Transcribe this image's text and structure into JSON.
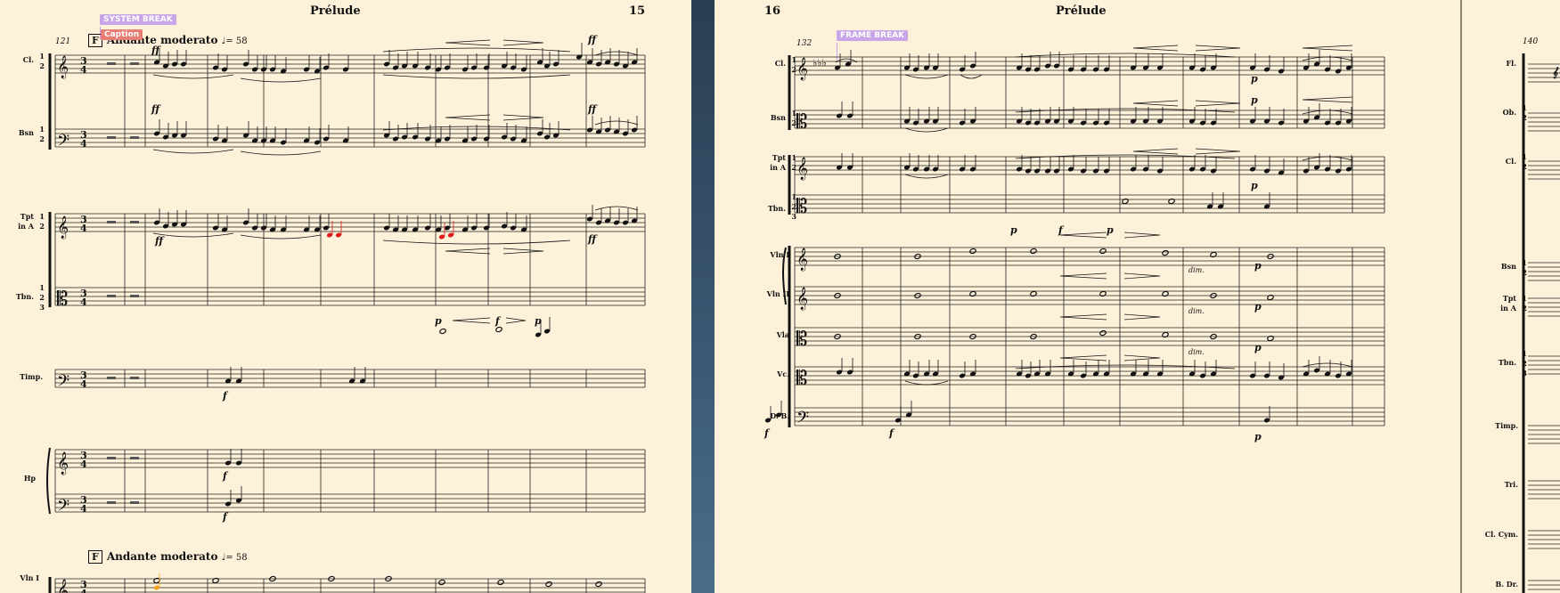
{
  "left_page": {
    "title": "Prélude",
    "page_number": "15",
    "measure_start": "121",
    "rehearsal_mark": "F",
    "tempo": "Andante moderato",
    "metronome": "♩= 58",
    "system_break_label": "SYSTEM BREAK",
    "caption_label": "Caption",
    "instruments": [
      {
        "id": "cl",
        "label": "Cl.",
        "parts": "1\n2"
      },
      {
        "id": "bsn",
        "label": "Bsn",
        "parts": "1\n2"
      },
      {
        "id": "tpt",
        "label": "Tpt\nin A",
        "parts": "1\n2"
      },
      {
        "id": "tbn",
        "label": "Tbn.",
        "parts": "1\n2\n3"
      },
      {
        "id": "timp",
        "label": "Timp.",
        "parts": ""
      },
      {
        "id": "hp",
        "label": "Hp",
        "parts": ""
      },
      {
        "id": "vln1",
        "label": "Vln I",
        "parts": ""
      }
    ],
    "dynamics": [
      "ff",
      "ff",
      "ff",
      "ff",
      "ff",
      "p",
      "f",
      "p",
      "f",
      "f",
      "f"
    ]
  },
  "right_page": {
    "title": "Prélude",
    "page_number": "16",
    "measure_start": "132",
    "frame_break_label": "FRAME BREAK",
    "instruments": [
      {
        "id": "cl",
        "label": "Cl.",
        "parts": "1\n2"
      },
      {
        "id": "bsn",
        "label": "Bsn",
        "parts": "1\n2"
      },
      {
        "id": "tpt",
        "label": "Tpt\nin A",
        "parts": "1\n2"
      },
      {
        "id": "tbn",
        "label": "Tbn.",
        "parts": "1\n2\n3"
      },
      {
        "id": "vln1",
        "label": "Vln I",
        "parts": ""
      },
      {
        "id": "vln2",
        "label": "Vln II",
        "parts": ""
      },
      {
        "id": "vla",
        "label": "Vla",
        "parts": ""
      },
      {
        "id": "vc",
        "label": "Vc.",
        "parts": ""
      },
      {
        "id": "db",
        "label": "D. B.",
        "parts": ""
      }
    ],
    "dim_label": "dim.",
    "dynamics": [
      "p",
      "p",
      "p",
      "f",
      "p",
      "p",
      "f",
      "p",
      "p",
      "p",
      "p",
      "p"
    ]
  },
  "next_page": {
    "measure_start": "140",
    "instruments": [
      {
        "id": "fl",
        "label": "Fl.",
        "parts": ""
      },
      {
        "id": "ob",
        "label": "Ob.",
        "parts": "1\n2"
      },
      {
        "id": "cl",
        "label": "Cl.",
        "parts": "1\n2"
      },
      {
        "id": "bsn",
        "label": "Bsn",
        "parts": "1\n2"
      },
      {
        "id": "tpt",
        "label": "Tpt\nin A",
        "parts": "1\n2"
      },
      {
        "id": "tbn",
        "label": "Tbn.",
        "parts": "1\n2\n3"
      },
      {
        "id": "timp",
        "label": "Timp.",
        "parts": ""
      },
      {
        "id": "tri",
        "label": "Tri.",
        "parts": ""
      },
      {
        "id": "clcym",
        "label": "Cl. Cym.",
        "parts": ""
      },
      {
        "id": "bdr",
        "label": "B. Dr.",
        "parts": ""
      }
    ]
  },
  "colors": {
    "paper": "#fdf1da",
    "desk": "#3a5670",
    "break_tag": "#c7a5e6",
    "caption_tag": "#e87e74",
    "selected_note": "#e01b1b",
    "highlight_note": "#f0a21e"
  }
}
